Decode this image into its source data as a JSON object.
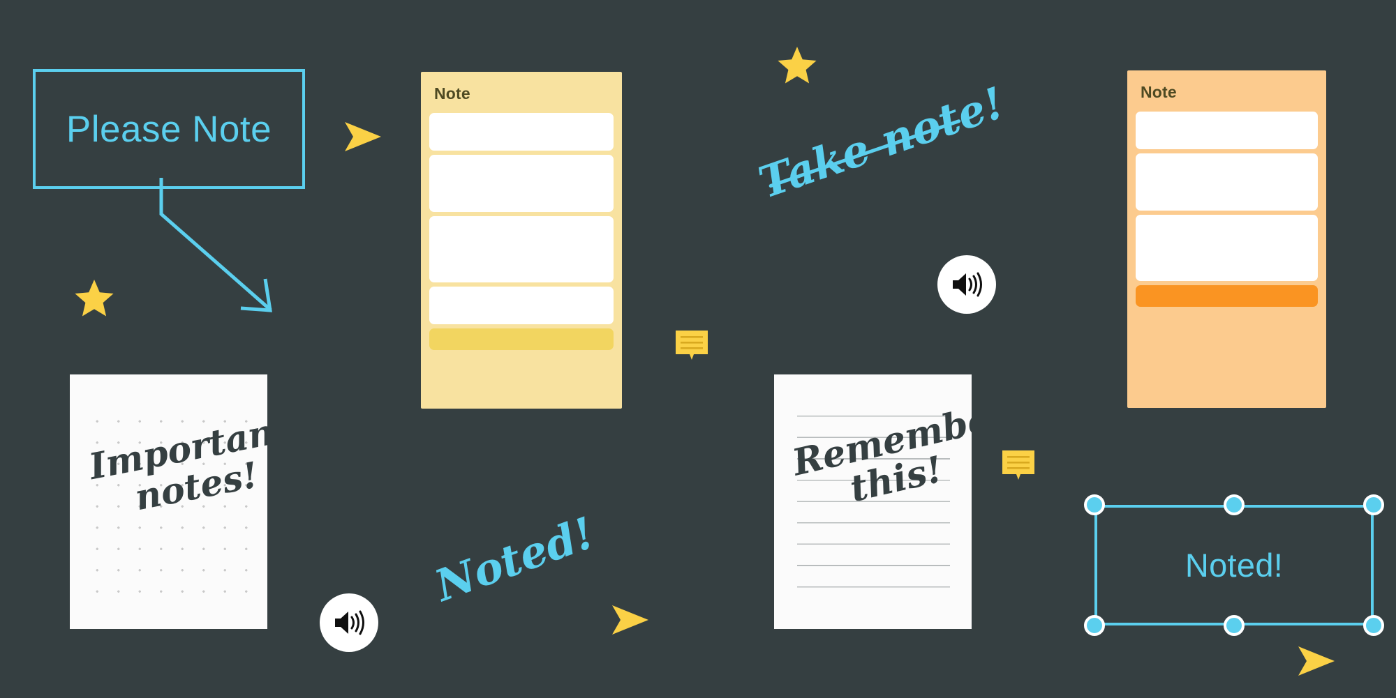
{
  "board": {
    "background_color": "#353F41",
    "accent_cyan": "#5BCFEE",
    "accent_yellow": "#FBD146",
    "accent_orange": "#FA9422",
    "ink_dark": "#353F41"
  },
  "please_note_box": {
    "label": "Please Note",
    "border_color": "#5BCFEE",
    "text_color": "#5BCFEE"
  },
  "connector": {
    "name": "elbow-arrow",
    "color": "#5BCFEE"
  },
  "note_cards": [
    {
      "id": "yellow",
      "title": "Note",
      "background_color": "#F8E2A0",
      "title_color": "#4E4A22",
      "highlight_color": "#F2D560",
      "row_color": "#FFFFFF",
      "row_count": 4,
      "has_highlight_row": true
    },
    {
      "id": "orange",
      "title": "Note",
      "background_color": "#FCCB8E",
      "title_color": "#4E4A22",
      "highlight_color": "#FA9422",
      "row_color": "#FFFFFF",
      "row_count": 3,
      "has_highlight_row": true
    }
  ],
  "papers": [
    {
      "id": "dotted",
      "paper_style": "dotted-grid",
      "line1": "Important",
      "line2": "notes!",
      "ink_color": "#353F41",
      "paper_color": "#FBFBFB"
    },
    {
      "id": "lined",
      "paper_style": "ruled-lines",
      "line1": "Remember",
      "line2": "this!",
      "ink_color": "#353F41",
      "paper_color": "#FBFBFB"
    }
  ],
  "script_texts": [
    {
      "id": "take-note",
      "text": "Take note!",
      "color": "#5BCFEE",
      "underlined": true
    },
    {
      "id": "noted-script",
      "text": "Noted!",
      "color": "#5BCFEE",
      "underlined": false
    }
  ],
  "selection_box": {
    "label": "Noted!",
    "border_color": "#5BCFEE",
    "text_color": "#5BCFEE",
    "handle_fill": "#5BCFEE",
    "handle_ring": "#FFFFFF",
    "handle_count": 6
  },
  "speakers": [
    {
      "id": "speaker-top",
      "icon": "speaker-volume-icon",
      "circle_color": "#FFFFFF",
      "glyph_color": "#0F0F0F"
    },
    {
      "id": "speaker-bottom",
      "icon": "speaker-volume-icon",
      "circle_color": "#FFFFFF",
      "glyph_color": "#0F0F0F"
    }
  ],
  "glyphs": {
    "stars": [
      {
        "id": "star-top",
        "icon": "star-icon",
        "color": "#FBD146"
      },
      {
        "id": "star-left",
        "icon": "star-icon",
        "color": "#FBD146"
      }
    ],
    "arrows": [
      {
        "id": "arrow-1",
        "icon": "play-arrow-icon",
        "color": "#FBD146"
      },
      {
        "id": "arrow-2",
        "icon": "play-arrow-icon",
        "color": "#FBD146"
      },
      {
        "id": "arrow-3",
        "icon": "play-arrow-icon",
        "color": "#FBD146"
      }
    ],
    "bubbles": [
      {
        "id": "bubble-1",
        "icon": "comment-bubble-icon",
        "color": "#FBD146",
        "line_count": 3
      },
      {
        "id": "bubble-2",
        "icon": "comment-bubble-icon",
        "color": "#FBD146",
        "line_count": 3
      }
    ]
  }
}
